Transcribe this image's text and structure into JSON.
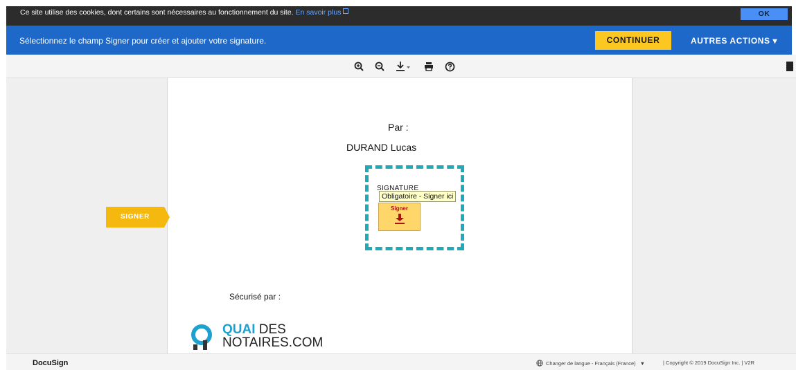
{
  "cookie_bar": {
    "text": "Ce site utilise des cookies, dont certains sont nécessaires au fonctionnement du site.",
    "link_text": "En savoir plus",
    "ok_label": "OK"
  },
  "action_bar": {
    "message": "Sélectionnez le champ Signer pour créer et ajouter votre signature.",
    "continue_label": "CONTINUER",
    "more_actions_label": "AUTRES ACTIONS ▾"
  },
  "toolbar": {
    "icons": [
      "zoom-in-icon",
      "zoom-out-icon",
      "download-icon",
      "print-icon",
      "help-icon"
    ]
  },
  "document": {
    "par_label": "Par :",
    "signer_name": "DURAND Lucas",
    "signature_field_title": "SIGNATURE",
    "tooltip": "Obligatoire - Signer ici",
    "sign_button_label": "Signer",
    "secured_by": "Sécurisé par :",
    "logo": {
      "line1_accent": "QUAI",
      "line1_rest": " DES",
      "line2": "NOTAIRES.COM"
    }
  },
  "signer_tab": {
    "label": "SIGNER"
  },
  "footer": {
    "brand": "DocuSign",
    "language": "Changer de langue - Français (France)",
    "copyright": "|   Copyright © 2019 DocuSign Inc.  |  V2R"
  },
  "colors": {
    "brand_blue": "#1e68c9",
    "continue_yellow": "#fcc721",
    "signer_tab": "#f5b80f",
    "field_border": "#22a9b8"
  }
}
